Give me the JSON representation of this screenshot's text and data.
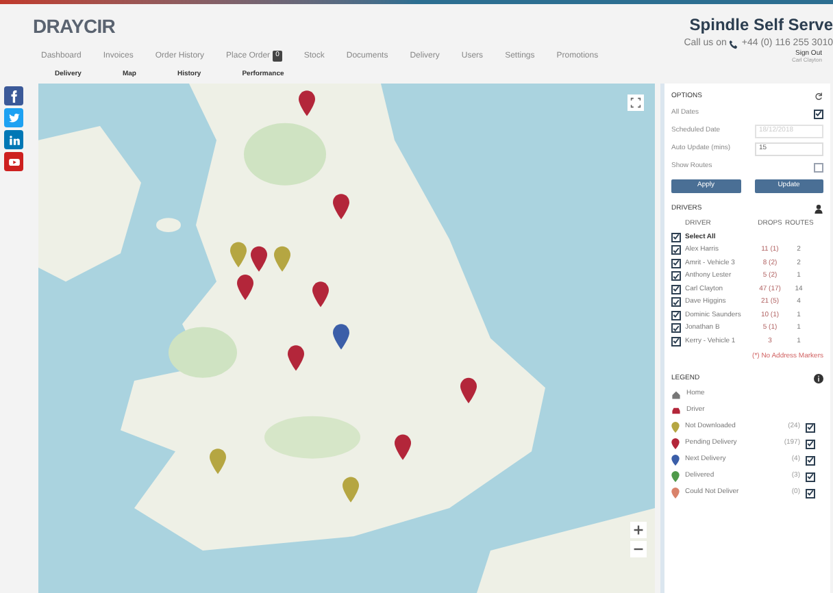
{
  "header": {
    "logo": "DRAYCIR",
    "title": "Spindle Self Serve",
    "call_label": "Call us on",
    "phone": "+44 (0) 116 255 3010",
    "sign_out": "Sign Out",
    "user": "Carl Clayton"
  },
  "nav": [
    {
      "label": "Dashboard"
    },
    {
      "label": "Invoices"
    },
    {
      "label": "Order History"
    },
    {
      "label": "Place Order",
      "badge": "0"
    },
    {
      "label": "Stock"
    },
    {
      "label": "Documents"
    },
    {
      "label": "Delivery"
    },
    {
      "label": "Users"
    },
    {
      "label": "Settings"
    },
    {
      "label": "Promotions"
    }
  ],
  "subnav": [
    "Delivery",
    "Map",
    "History",
    "Performance"
  ],
  "social": [
    {
      "kind": "facebook",
      "color": "#3b5998"
    },
    {
      "kind": "twitter",
      "color": "#1da1f2"
    },
    {
      "kind": "linkedin",
      "color": "#0077b5"
    },
    {
      "kind": "youtube",
      "color": "#cd201f"
    }
  ],
  "options": {
    "title": "OPTIONS",
    "rows": [
      {
        "kind": "checkbox",
        "label": "All Dates",
        "checked": true
      },
      {
        "kind": "select",
        "label": "Scheduled Date",
        "value": "18/12/2018",
        "disabled": true
      },
      {
        "kind": "input",
        "label": "Auto Update (mins)",
        "value": "15"
      },
      {
        "kind": "checkbox",
        "label": "Show Routes",
        "checked": false
      }
    ],
    "buttons": [
      "Apply",
      "Update"
    ]
  },
  "drivers": {
    "title": "DRIVERS",
    "columns": [
      "DRIVER",
      "DROPS",
      "ROUTES"
    ],
    "select_all": {
      "label": "Select All",
      "checked": true
    },
    "rows": [
      {
        "name": "Alex Harris",
        "drops": "11 (1)",
        "routes": "2",
        "checked": true
      },
      {
        "name": "Amrit - Vehicle 3",
        "drops": "8 (2)",
        "routes": "2",
        "checked": true
      },
      {
        "name": "Anthony Lester",
        "drops": "5 (2)",
        "routes": "1",
        "checked": true
      },
      {
        "name": "Carl Clayton",
        "drops": "47 (17)",
        "routes": "14",
        "checked": true
      },
      {
        "name": "Dave Higgins",
        "drops": "21 (5)",
        "routes": "4",
        "checked": true
      },
      {
        "name": "Dominic Saunders",
        "drops": "10 (1)",
        "routes": "1",
        "checked": true
      },
      {
        "name": "Jonathan B",
        "drops": "5 (1)",
        "routes": "1",
        "checked": true
      },
      {
        "name": "Kerry - Vehicle 1",
        "drops": "3",
        "routes": "1",
        "checked": true
      }
    ],
    "note": "(*) No Address Markers"
  },
  "legend": {
    "title": "LEGEND",
    "items": [
      {
        "kind": "home",
        "label": "Home"
      },
      {
        "kind": "driver",
        "label": "Driver"
      },
      {
        "kind": "pin",
        "label": "Not Downloaded",
        "color": "#b5a642",
        "count": "(24)",
        "checked": true
      },
      {
        "kind": "pin",
        "label": "Pending Delivery",
        "color": "#b3263a",
        "count": "(197)",
        "checked": true
      },
      {
        "kind": "pin",
        "label": "Next Delivery",
        "color": "#3b5ea8",
        "count": "(4)",
        "checked": true
      },
      {
        "kind": "pin",
        "label": "Delivered",
        "color": "#4f9a4a",
        "count": "(3)",
        "checked": true
      },
      {
        "kind": "pin",
        "label": "Could Not Deliver",
        "color": "#d9826a",
        "count": "(0)",
        "checked": true
      }
    ]
  }
}
